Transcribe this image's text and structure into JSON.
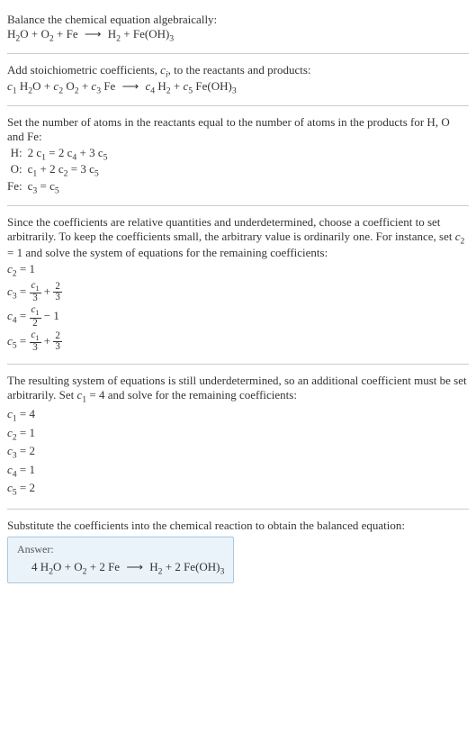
{
  "step1": {
    "text": "Balance the chemical equation algebraically:",
    "eq_lhs_h2o": "H",
    "eq_lhs_h2o_sub": "2",
    "eq_lhs_h2o_o": "O",
    "plus1": " + ",
    "eq_lhs_o2": "O",
    "eq_lhs_o2_sub": "2",
    "plus2": " + ",
    "eq_lhs_fe": "Fe",
    "arrow": "⟶",
    "eq_rhs_h2": "H",
    "eq_rhs_h2_sub": "2",
    "plus3": " + ",
    "eq_rhs_feoh3_fe": "Fe(OH)",
    "eq_rhs_feoh3_sub": "3"
  },
  "step2": {
    "text_a": "Add stoichiometric coefficients, ",
    "ci": "c",
    "ci_sub": "i",
    "text_b": ", to the reactants and products:",
    "c1": "c",
    "c1_sub": "1",
    "sp1": " H",
    "h2o_sub": "2",
    "o": "O",
    "p1": " + ",
    "c2": "c",
    "c2_sub": "2",
    "sp2": " O",
    "o2_sub": "2",
    "p2": " + ",
    "c3": "c",
    "c3_sub": "3",
    "sp3": " Fe",
    "arrow": "⟶",
    "c4": "c",
    "c4_sub": "4",
    "sp4": " H",
    "h2_sub": "2",
    "p3": " + ",
    "c5": "c",
    "c5_sub": "5",
    "sp5": " Fe(OH)",
    "feoh3_sub": "3"
  },
  "step3": {
    "text": "Set the number of atoms in the reactants equal to the number of atoms in the products for H, O and Fe:",
    "rows": [
      {
        "label": "H:",
        "c": "2 c",
        "s1": "1",
        "eq": " = 2 c",
        "s2": "4",
        "t": " + 3 c",
        "s3": "5"
      },
      {
        "label": "O:",
        "c": "c",
        "s1": "1",
        "eq": " + 2 c",
        "s2": "2",
        "t": " = 3 c",
        "s3": "5"
      },
      {
        "label": "Fe:",
        "c": "c",
        "s1": "3",
        "eq": " = c",
        "s2": "5",
        "t": "",
        "s3": ""
      }
    ]
  },
  "step4": {
    "text_a": "Since the coefficients are relative quantities and underdetermined, choose a coefficient to set arbitrarily. To keep the coefficients small, the arbitrary value is ordinarily one. For instance, set ",
    "c2": "c",
    "c2_sub": "2",
    "eq1": " = 1",
    "text_b": " and solve the system of equations for the remaining coefficients:",
    "l1_a": "c",
    "l1_s": "2",
    "l1_b": " = 1",
    "l2_a": "c",
    "l2_s": "3",
    "l2_b": " = ",
    "l2_n1": "c",
    "l2_n1s": "1",
    "l2_d1": "3",
    "l2_p": " + ",
    "l2_n2": "2",
    "l2_d2": "3",
    "l3_a": "c",
    "l3_s": "4",
    "l3_b": " = ",
    "l3_n1": "c",
    "l3_n1s": "1",
    "l3_d1": "2",
    "l3_p": " − 1",
    "l4_a": "c",
    "l4_s": "5",
    "l4_b": " = ",
    "l4_n1": "c",
    "l4_n1s": "1",
    "l4_d1": "3",
    "l4_p": " + ",
    "l4_n2": "2",
    "l4_d2": "3"
  },
  "step5": {
    "text_a": "The resulting system of equations is still underdetermined, so an additional coefficient must be set arbitrarily. Set ",
    "c1": "c",
    "c1_sub": "1",
    "eq": " = 4",
    "text_b": " and solve for the remaining coefficients:",
    "lines": [
      {
        "c": "c",
        "s": "1",
        "v": " = 4"
      },
      {
        "c": "c",
        "s": "2",
        "v": " = 1"
      },
      {
        "c": "c",
        "s": "3",
        "v": " = 2"
      },
      {
        "c": "c",
        "s": "4",
        "v": " = 1"
      },
      {
        "c": "c",
        "s": "5",
        "v": " = 2"
      }
    ]
  },
  "step6": {
    "text": "Substitute the coefficients into the chemical reaction to obtain the balanced equation:",
    "answer_label": "Answer:",
    "a": "4 H",
    "a_s": "2",
    "a2": "O + O",
    "a2_s": "2",
    "a3": " + 2 Fe ",
    "arrow": "⟶",
    "b": " H",
    "b_s": "2",
    "b2": " + 2 Fe(OH)",
    "b2_s": "3"
  }
}
